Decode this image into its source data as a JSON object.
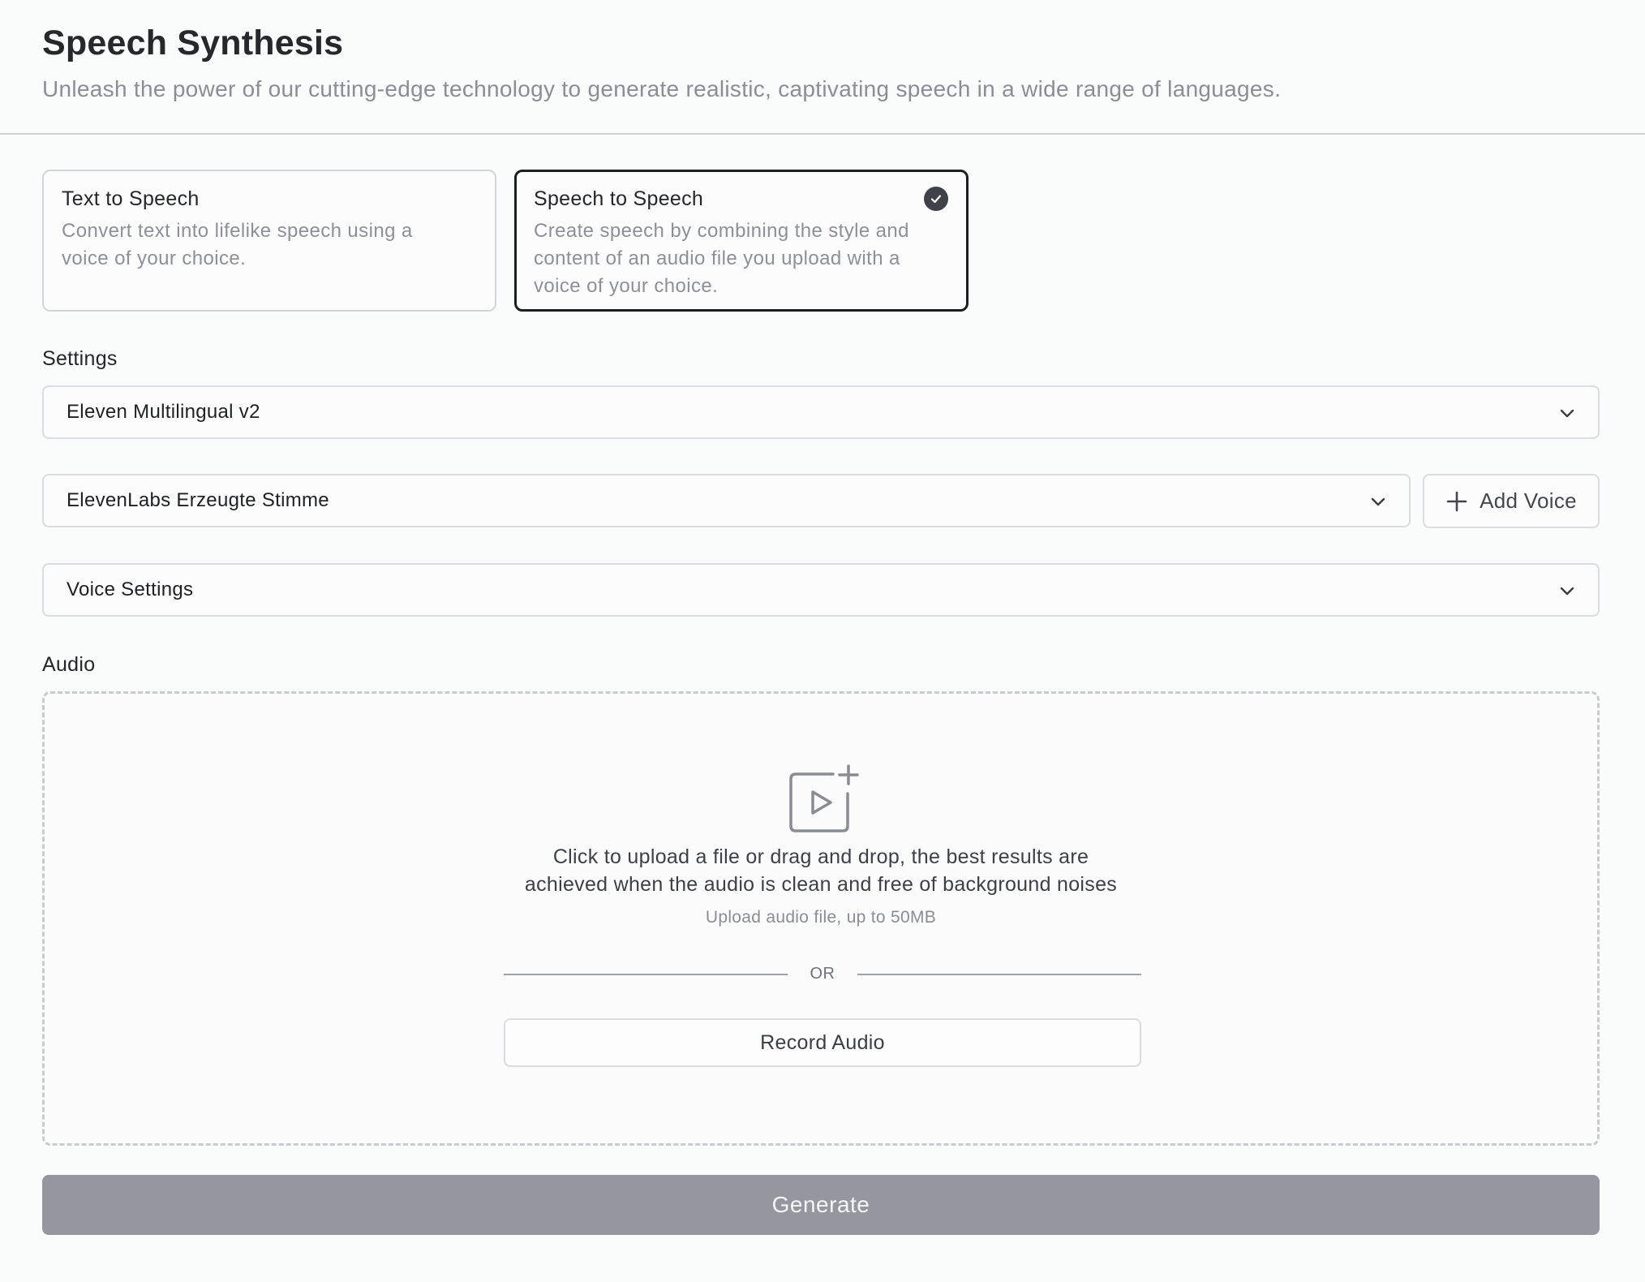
{
  "header": {
    "title": "Speech Synthesis",
    "subtitle": "Unleash the power of our cutting-edge technology to generate realistic, captivating speech in a wide range of languages."
  },
  "modes": [
    {
      "title": "Text to Speech",
      "description": "Convert text into lifelike speech using a voice of your choice.",
      "selected": false
    },
    {
      "title": "Speech to Speech",
      "description": "Create speech by combining the style and content of an audio file you upload with a voice of your choice.",
      "selected": true
    }
  ],
  "settings": {
    "label": "Settings",
    "model_select": "Eleven Multilingual v2",
    "voice_select": "ElevenLabs Erzeugte Stimme",
    "add_voice_label": "Add Voice",
    "voice_settings_label": "Voice Settings"
  },
  "audio": {
    "label": "Audio",
    "upload_line1": "Click to upload a file or drag and drop, the best results are",
    "upload_line2": "achieved when the audio is clean and free of background noises",
    "upload_sub": "Upload audio file, up to 50MB",
    "or_text": "OR",
    "record_label": "Record Audio"
  },
  "generate_label": "Generate",
  "icons": {
    "check": "check-circle-icon",
    "chevron": "chevron-down-icon",
    "plus": "plus-icon",
    "upload": "video-upload-icon"
  },
  "colors": {
    "selected_border": "#1d1e24",
    "generate_bg": "#96969f"
  }
}
